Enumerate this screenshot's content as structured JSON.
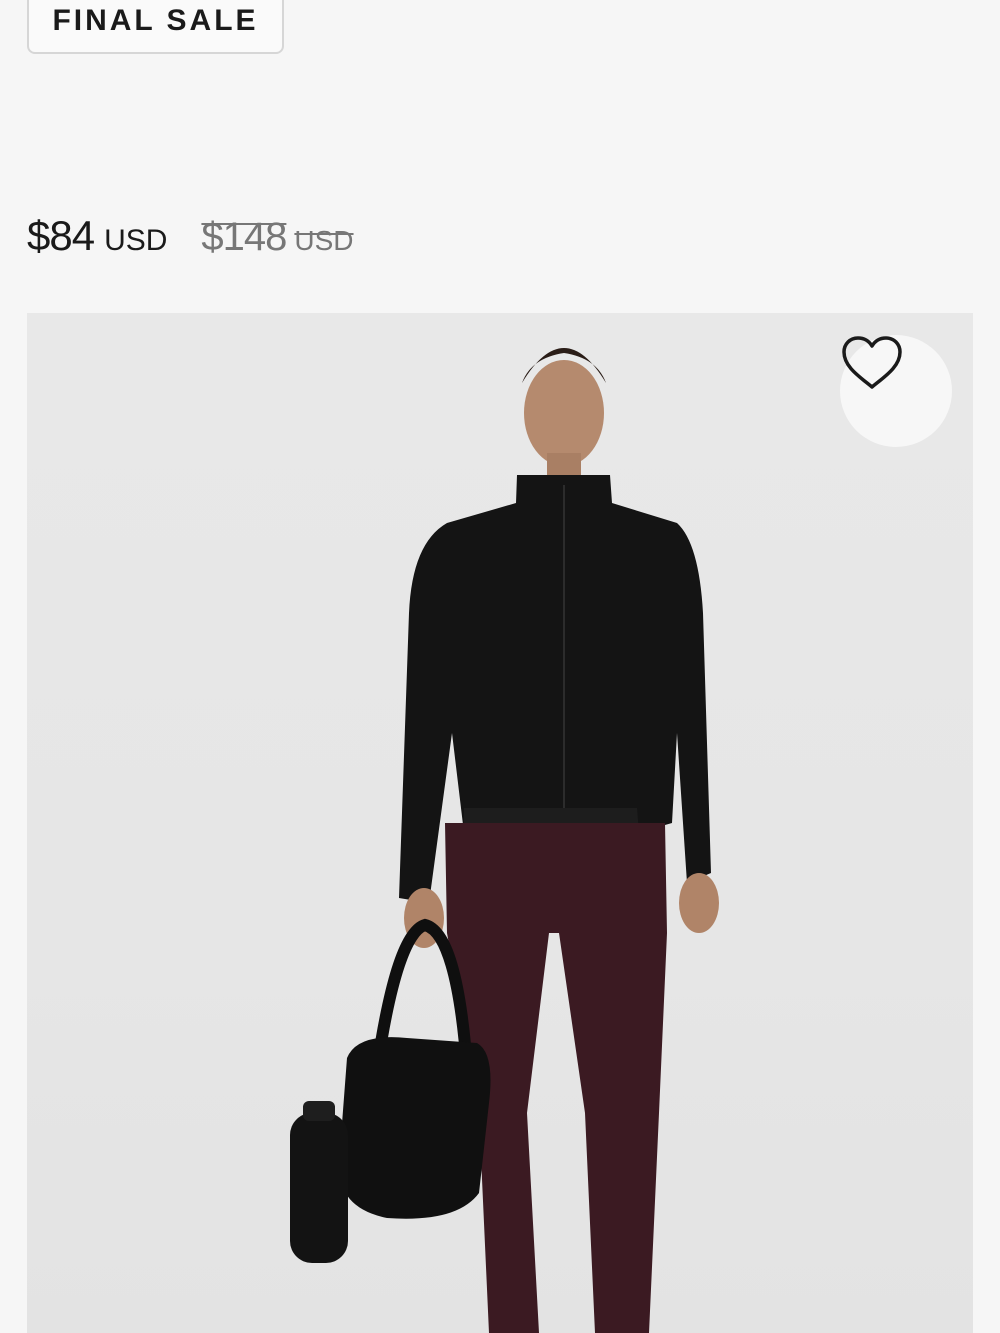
{
  "badge": {
    "label": "FINAL SALE"
  },
  "price": {
    "current_amount": "$84",
    "current_currency": "USD",
    "original_amount": "$148",
    "original_currency": "USD"
  },
  "product_image": {
    "wishlist_icon": "heart-icon"
  },
  "colors": {
    "page_background": "#f6f6f6",
    "image_background": "#e6e6e6",
    "jacket": "#141414",
    "leggings": "#3b1a22",
    "strikethrough_text": "#777777"
  }
}
